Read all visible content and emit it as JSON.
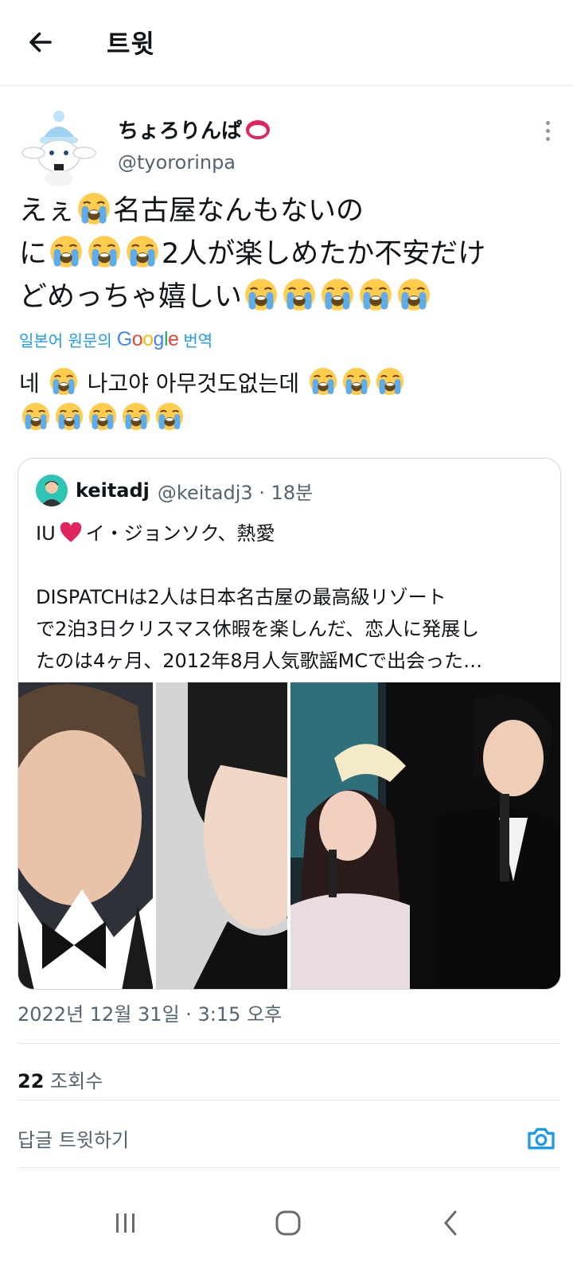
{
  "header": {
    "title": "트윗"
  },
  "tweet": {
    "display_name": "ちょろりんぱ",
    "handle": "@tyororinpa",
    "text_line1": "えぇ",
    "text_line1b": "名古屋なんもないの",
    "text_line2a": "に",
    "text_line2b": "2人が楽しめたか不安だけ",
    "text_line3": "どめっちゃ嬉しい",
    "translate_prefix": "일본어 원문의",
    "translate_google": "Google",
    "translate_suffix": "번역",
    "translated_text": "네",
    "translated_text2": "나고야 아무것도없는데",
    "timestamp": "2022년 12월 31일 · 3:15 오후",
    "views_count": "22",
    "views_label": "조회수"
  },
  "quote": {
    "name": "keitadj",
    "handle": "@keitadj3 · 18분",
    "line1_prefix": "IU",
    "line1_suffix": "イ・ジョンソク、熱愛",
    "line2": "DISPATCHは2人は日本名古屋の最高級リゾート",
    "line3": "で2泊3日クリスマス休暇を楽しんだ、恋人に発展し",
    "line4": "たのは4ヶ月、2012年8月人気歌謡MCで出会った…"
  },
  "reply": {
    "placeholder": "답글 트윗하기"
  },
  "icons": {
    "back": "arrow-left-icon",
    "more": "vertical-dots-icon",
    "emoji": "loudly-crying-face-emoji",
    "camera": "camera-icon",
    "recents": "recent-apps-icon",
    "home": "home-icon",
    "nav_back": "chevron-left-icon"
  },
  "colors": {
    "accent": "#1d9bf0",
    "secondary_text": "#536471",
    "heart": "#e0245e"
  }
}
